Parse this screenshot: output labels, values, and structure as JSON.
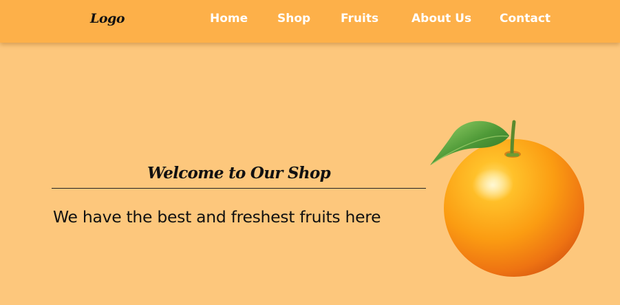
{
  "logo": {
    "text": "Logo"
  },
  "nav": {
    "items": [
      {
        "label": "Home"
      },
      {
        "label": "Shop"
      },
      {
        "label": "Fruits"
      },
      {
        "label": "About Us"
      },
      {
        "label": "Contact"
      }
    ]
  },
  "hero": {
    "title": "Welcome to Our Shop",
    "subtitle": "We have the best and freshest fruits here",
    "image": "orange-fruit"
  },
  "colors": {
    "navbar_bg": "#fdb049",
    "page_bg": "#fdc77c",
    "nav_text": "#ffffff",
    "text": "#111111"
  }
}
